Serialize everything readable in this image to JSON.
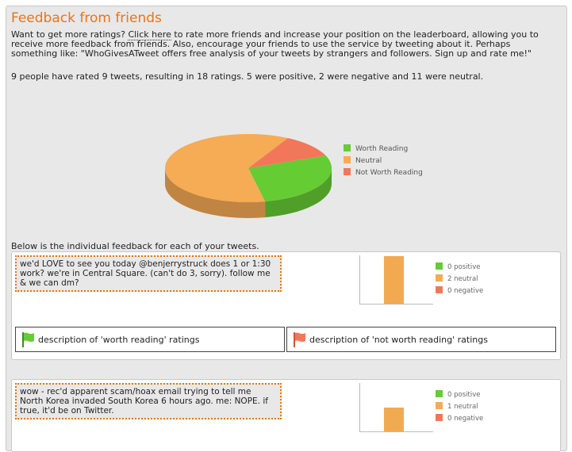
{
  "title": "Feedback from friends",
  "intro": {
    "part1": "Want to get more ratings? ",
    "link": "Click here",
    "part2": " to rate more friends and increase your position on the leaderboard, allowing you to receive more feedback from friends. Also, encourage your friends to use the service by tweeting about it. Perhaps something like: \"WhoGivesATweet offers free analysis of your tweets by strangers and followers. Sign up and rate me!\""
  },
  "stats": "9 people have rated 9 tweets, resulting in 18 ratings. 5 were positive, 2 were negative and 11 were neutral.",
  "chart_data": {
    "type": "pie",
    "categories": [
      "Worth Reading",
      "Neutral",
      "Not Worth Reading"
    ],
    "values": [
      5,
      11,
      2
    ],
    "colors": [
      "#66cc33",
      "#f6ab55",
      "#f2775a"
    ]
  },
  "below_text": "Below is the individual feedback for each of your tweets.",
  "tweets": [
    {
      "text": "we'd LOVE to see you today @benjerrystruck does 1 or 1:30 work? we're in Central Square. (can't do 3, sorry). follow me & we can dm?",
      "chart_data": {
        "type": "bar",
        "categories": [
          "positive",
          "neutral",
          "negative"
        ],
        "values": [
          0,
          2,
          0
        ]
      },
      "legend": [
        "0 positive",
        "2 neutral",
        "0 negative"
      ],
      "worth_desc": "description of 'worth reading' ratings",
      "notworth_desc": "description of 'not worth reading' ratings"
    },
    {
      "text": "wow - rec'd apparent scam/hoax email trying to tell me North Korea invaded South Korea 6 hours ago. me: NOPE. if true, it'd be on Twitter.",
      "chart_data": {
        "type": "bar",
        "categories": [
          "positive",
          "neutral",
          "negative"
        ],
        "values": [
          0,
          1,
          0
        ]
      },
      "legend": [
        "0 positive",
        "1 neutral",
        "0 negative"
      ]
    }
  ],
  "colors": {
    "accent": "#e8751a",
    "positive": "#66cc33",
    "neutral": "#f6ab55",
    "negative": "#f2775a"
  }
}
